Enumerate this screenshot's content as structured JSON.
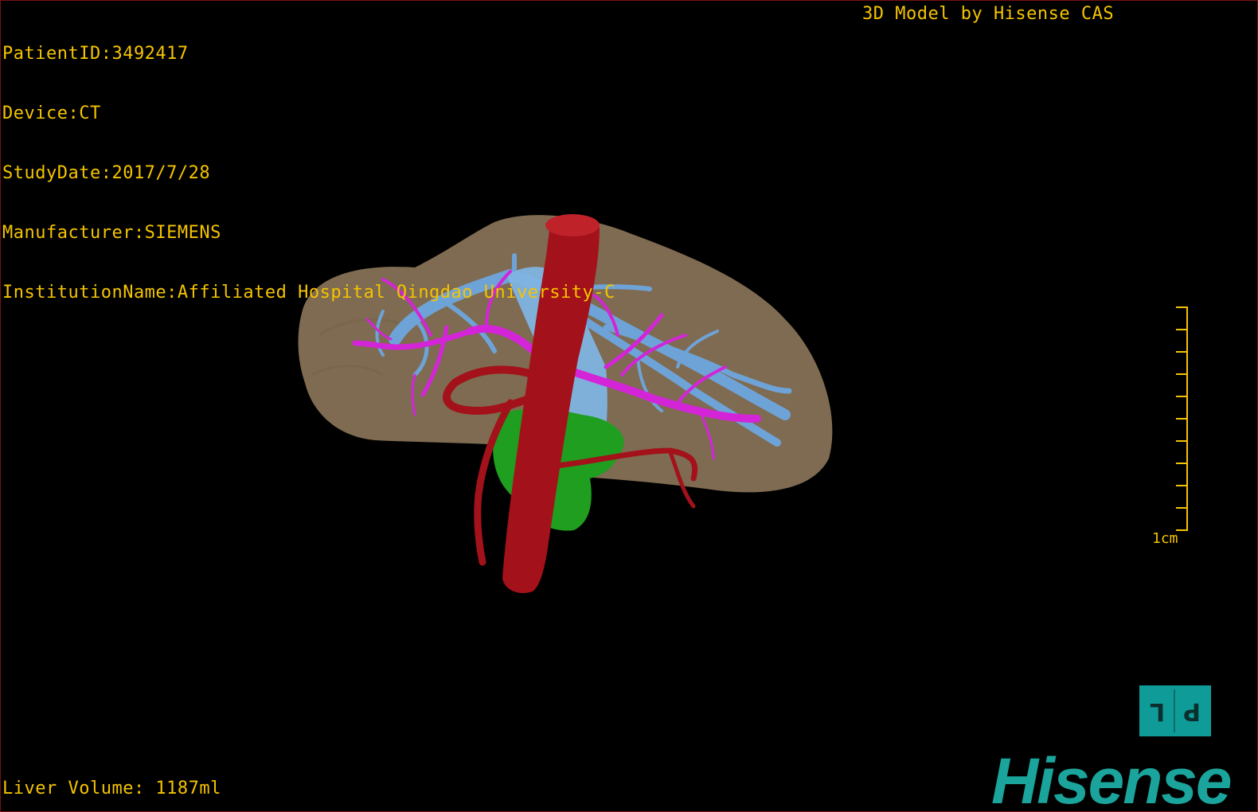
{
  "info": {
    "patient_id": "PatientID:3492417",
    "device": "Device:CT",
    "study_date": "StudyDate:2017/7/28",
    "manufacturer": "Manufacturer:SIEMENS",
    "institution": "InstitutionName:Affiliated Hospital Qingdao University-C"
  },
  "credit": "3D Model by Hisense CAS",
  "liver_volume": "Liver Volume: 1187ml",
  "scale": {
    "label": "1cm"
  },
  "orientation": {
    "left_mark": "L",
    "right_mark": "P"
  },
  "logo": "Hisense",
  "colors": {
    "overlay_text": "#f5c400",
    "liver": "#8a7458",
    "portal_vein": "#6ea3d8",
    "hepatic_artery": "#d324d8",
    "aorta": "#a3121a",
    "kidney_green": "#1f9e1f",
    "brand": "#1aa49b"
  },
  "model": {
    "structures": [
      "liver-surface",
      "hepatic-veins",
      "hepatic-artery",
      "aorta",
      "inferior-vena-cava",
      "green-structure"
    ]
  }
}
